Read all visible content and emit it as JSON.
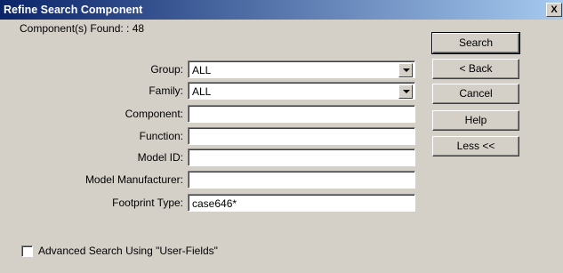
{
  "window": {
    "title": "Refine Search Component",
    "close_label": "X"
  },
  "status": {
    "found_text": "Component(s) Found: : 48"
  },
  "fields": [
    {
      "label": "Group:",
      "value": "ALL"
    },
    {
      "label": "Family:",
      "value": "ALL"
    },
    {
      "label": "Component:",
      "value": ""
    },
    {
      "label": "Function:",
      "value": ""
    },
    {
      "label": "Model ID:",
      "value": ""
    },
    {
      "label": "Model Manufacturer:",
      "value": ""
    },
    {
      "label": "Footprint Type:",
      "value": "case646*"
    }
  ],
  "buttons": {
    "search": "Search",
    "back": "< Back",
    "cancel": "Cancel",
    "help": "Help",
    "less": "Less <<"
  },
  "advanced": {
    "label": "Advanced Search Using \"User-Fields\"",
    "checked": false
  },
  "colors": {
    "title_start": "#0a246a",
    "title_end": "#a6caf0",
    "face": "#d4d0c8"
  }
}
